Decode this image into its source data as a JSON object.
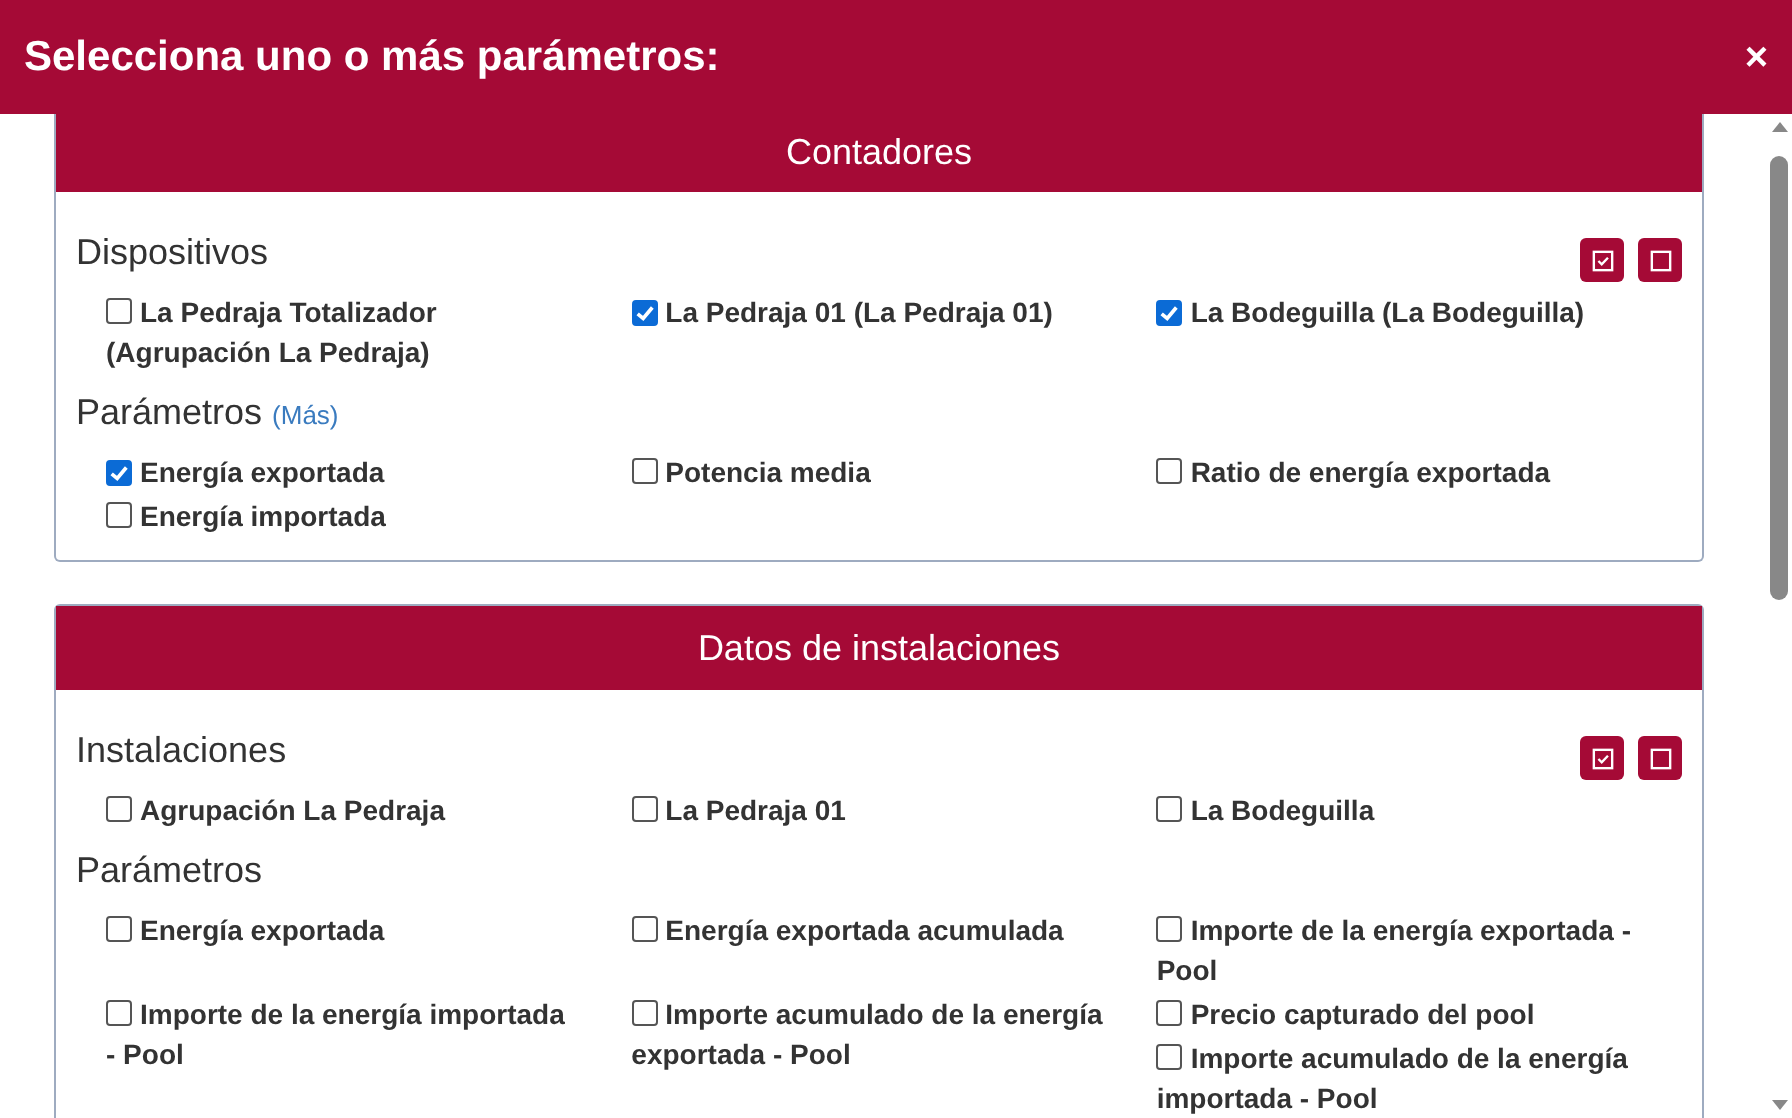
{
  "dialog": {
    "title": "Selecciona uno o más parámetros:",
    "close": "×"
  },
  "sections": [
    {
      "title": "Contadores",
      "groups": [
        {
          "label": "Dispositivos",
          "bulk_buttons": true,
          "items": [
            {
              "label": "La Pedraja Totalizador (Agrupación La Pedraja)",
              "checked": false
            },
            {
              "label": "La Pedraja 01 (La Pedraja 01)",
              "checked": true
            },
            {
              "label": "La Bodeguilla (La Bodeguilla)",
              "checked": true
            }
          ]
        },
        {
          "label": "Parámetros",
          "more_link": "(Más)",
          "bulk_buttons": false,
          "items": [
            {
              "label": "Energía exportada",
              "checked": true
            },
            {
              "label": "Potencia media",
              "checked": false
            },
            {
              "label": "Ratio de energía exportada",
              "checked": false
            },
            {
              "label": "Energía importada",
              "checked": false
            }
          ]
        }
      ]
    },
    {
      "title": "Datos de instalaciones",
      "groups": [
        {
          "label": "Instalaciones",
          "bulk_buttons": true,
          "items": [
            {
              "label": "Agrupación La Pedraja",
              "checked": false
            },
            {
              "label": "La Pedraja 01",
              "checked": false
            },
            {
              "label": "La Bodeguilla",
              "checked": false
            }
          ]
        },
        {
          "label": "Parámetros",
          "bulk_buttons": false,
          "items": [
            {
              "label": "Energía exportada",
              "checked": false
            },
            {
              "label": "Energía exportada acumulada",
              "checked": false
            },
            {
              "label": "Importe de la energía exportada - Pool",
              "checked": false
            },
            {
              "label": "Importe de la energía importada - Pool",
              "checked": false
            },
            {
              "label": "Importe acumulado de la energía exportada - Pool",
              "checked": false
            },
            {
              "label": "Precio capturado del pool",
              "checked": false
            },
            {
              "label": "Importe acumulado de la energía importada - Pool",
              "checked": false
            }
          ]
        }
      ]
    }
  ]
}
